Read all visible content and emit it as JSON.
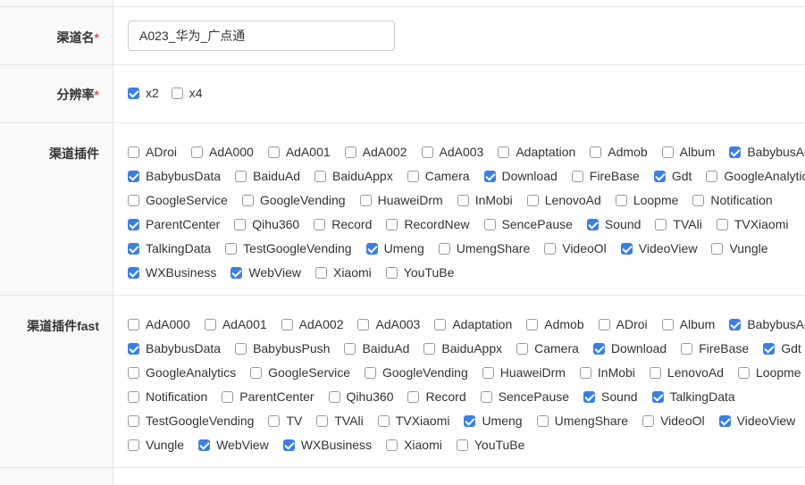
{
  "fields": {
    "channel_name": {
      "label": "渠道名",
      "required_mark": "*",
      "value": "A023_华为_广点通"
    },
    "resolution": {
      "label": "分辨率",
      "required_mark": "*",
      "options": [
        {
          "label": "x2",
          "checked": true
        },
        {
          "label": "x4",
          "checked": false
        }
      ]
    },
    "channel_plugins": {
      "label": "渠道插件",
      "rows": [
        [
          {
            "label": "ADroi",
            "checked": false
          },
          {
            "label": "AdA000",
            "checked": false
          },
          {
            "label": "AdA001",
            "checked": false
          },
          {
            "label": "AdA002",
            "checked": false
          },
          {
            "label": "AdA003",
            "checked": false
          },
          {
            "label": "Adaptation",
            "checked": false
          },
          {
            "label": "Admob",
            "checked": false
          },
          {
            "label": "Album",
            "checked": false
          },
          {
            "label": "BabybusAd",
            "checked": true
          }
        ],
        [
          {
            "label": "BabybusData",
            "checked": true
          },
          {
            "label": "BaiduAd",
            "checked": false
          },
          {
            "label": "BaiduAppx",
            "checked": false
          },
          {
            "label": "Camera",
            "checked": false
          },
          {
            "label": "Download",
            "checked": true
          },
          {
            "label": "FireBase",
            "checked": false
          },
          {
            "label": "Gdt",
            "checked": true
          },
          {
            "label": "GoogleAnalytics",
            "checked": false
          }
        ],
        [
          {
            "label": "GoogleService",
            "checked": false
          },
          {
            "label": "GoogleVending",
            "checked": false
          },
          {
            "label": "HuaweiDrm",
            "checked": false
          },
          {
            "label": "InMobi",
            "checked": false
          },
          {
            "label": "LenovoAd",
            "checked": false
          },
          {
            "label": "Loopme",
            "checked": false
          },
          {
            "label": "Notification",
            "checked": false
          }
        ],
        [
          {
            "label": "ParentCenter",
            "checked": true
          },
          {
            "label": "Qihu360",
            "checked": false
          },
          {
            "label": "Record",
            "checked": false
          },
          {
            "label": "RecordNew",
            "checked": false
          },
          {
            "label": "SencePause",
            "checked": false
          },
          {
            "label": "Sound",
            "checked": true
          },
          {
            "label": "TVAli",
            "checked": false
          },
          {
            "label": "TVXiaomi",
            "checked": false
          }
        ],
        [
          {
            "label": "TalkingData",
            "checked": true
          },
          {
            "label": "TestGoogleVending",
            "checked": false
          },
          {
            "label": "Umeng",
            "checked": true
          },
          {
            "label": "UmengShare",
            "checked": false
          },
          {
            "label": "VideoOl",
            "checked": false
          },
          {
            "label": "VideoView",
            "checked": true
          },
          {
            "label": "Vungle",
            "checked": false
          }
        ],
        [
          {
            "label": "WXBusiness",
            "checked": true
          },
          {
            "label": "WebView",
            "checked": true
          },
          {
            "label": "Xiaomi",
            "checked": false
          },
          {
            "label": "YouTuBe",
            "checked": false
          }
        ]
      ]
    },
    "channel_plugins_fast": {
      "label": "渠道插件fast",
      "rows": [
        [
          {
            "label": "AdA000",
            "checked": false
          },
          {
            "label": "AdA001",
            "checked": false
          },
          {
            "label": "AdA002",
            "checked": false
          },
          {
            "label": "AdA003",
            "checked": false
          },
          {
            "label": "Adaptation",
            "checked": false
          },
          {
            "label": "Admob",
            "checked": false
          },
          {
            "label": "ADroi",
            "checked": false
          },
          {
            "label": "Album",
            "checked": false
          },
          {
            "label": "BabybusAd",
            "checked": true
          }
        ],
        [
          {
            "label": "BabybusData",
            "checked": true
          },
          {
            "label": "BabybusPush",
            "checked": false
          },
          {
            "label": "BaiduAd",
            "checked": false
          },
          {
            "label": "BaiduAppx",
            "checked": false
          },
          {
            "label": "Camera",
            "checked": false
          },
          {
            "label": "Download",
            "checked": true
          },
          {
            "label": "FireBase",
            "checked": false
          },
          {
            "label": "Gdt",
            "checked": true
          }
        ],
        [
          {
            "label": "GoogleAnalytics",
            "checked": false
          },
          {
            "label": "GoogleService",
            "checked": false
          },
          {
            "label": "GoogleVending",
            "checked": false
          },
          {
            "label": "HuaweiDrm",
            "checked": false
          },
          {
            "label": "InMobi",
            "checked": false
          },
          {
            "label": "LenovoAd",
            "checked": false
          },
          {
            "label": "Loopme",
            "checked": false
          }
        ],
        [
          {
            "label": "Notification",
            "checked": false
          },
          {
            "label": "ParentCenter",
            "checked": false
          },
          {
            "label": "Qihu360",
            "checked": false
          },
          {
            "label": "Record",
            "checked": false
          },
          {
            "label": "SencePause",
            "checked": false
          },
          {
            "label": "Sound",
            "checked": true
          },
          {
            "label": "TalkingData",
            "checked": true
          }
        ],
        [
          {
            "label": "TestGoogleVending",
            "checked": false
          },
          {
            "label": "TV",
            "checked": false
          },
          {
            "label": "TVAli",
            "checked": false
          },
          {
            "label": "TVXiaomi",
            "checked": false
          },
          {
            "label": "Umeng",
            "checked": true
          },
          {
            "label": "UmengShare",
            "checked": false
          },
          {
            "label": "VideoOl",
            "checked": false
          },
          {
            "label": "VideoView",
            "checked": true
          }
        ],
        [
          {
            "label": "Vungle",
            "checked": false
          },
          {
            "label": "WebView",
            "checked": true
          },
          {
            "label": "WXBusiness",
            "checked": true
          },
          {
            "label": "Xiaomi",
            "checked": false
          },
          {
            "label": "YouTuBe",
            "checked": false
          }
        ]
      ]
    }
  },
  "colors": {
    "checkbox_checked": "#3b7fe1",
    "required": "#d9534f",
    "label_bg": "#f9f9f9",
    "border": "#e6e6e6"
  }
}
